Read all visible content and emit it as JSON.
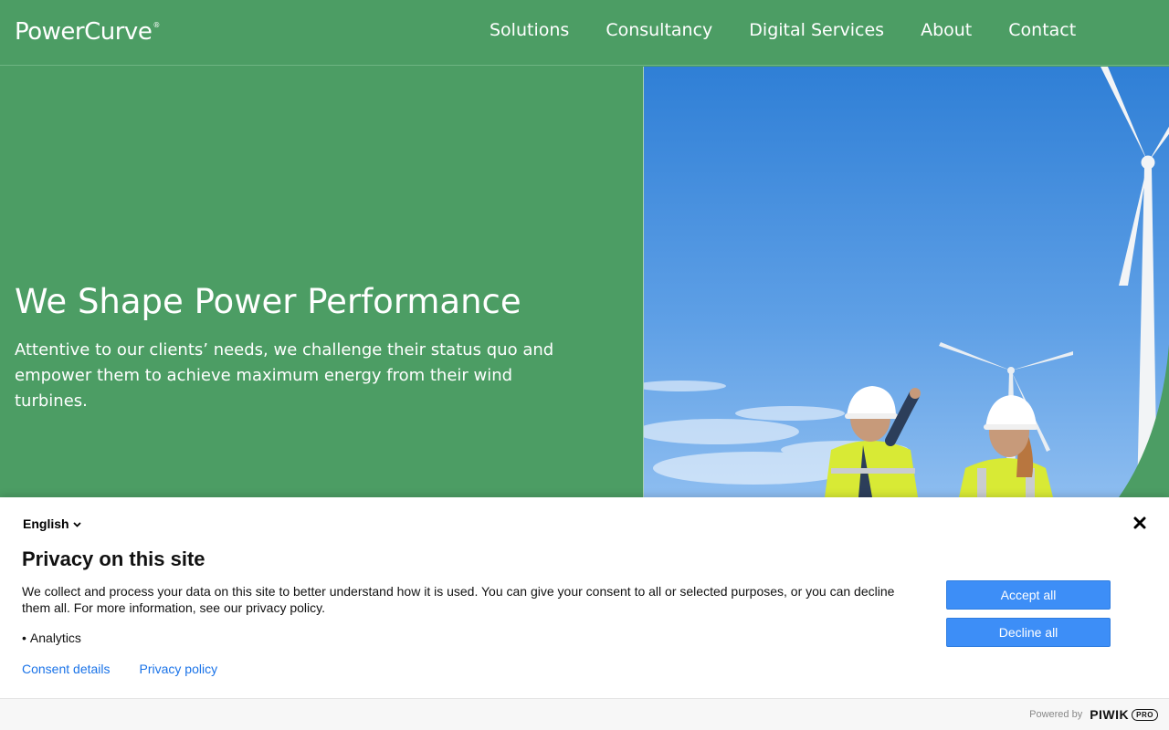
{
  "nav": {
    "logo": "PowerCurve",
    "logo_mark": "®",
    "items": [
      {
        "label": "Solutions"
      },
      {
        "label": "Consultancy"
      },
      {
        "label": "Digital Services"
      },
      {
        "label": "About"
      },
      {
        "label": "Contact"
      }
    ]
  },
  "hero": {
    "title": "We Shape Power Performance",
    "subtitle": "Attentive to our clients’ needs, we challenge their status quo and empower them to achieve maximum energy from their wind turbines."
  },
  "consent": {
    "language": "English",
    "title": "Privacy on this site",
    "text": "We collect and process your data on this site to better understand how it is used. You can give your consent to all or selected purposes, or you can decline them all. For more information, see our privacy policy.",
    "purposes": [
      "Analytics"
    ],
    "consent_details_label": "Consent details",
    "privacy_policy_label": "Privacy policy",
    "accept_label": "Accept all",
    "decline_label": "Decline all",
    "powered_by": "Powered by",
    "brand": "PIWIK",
    "brand_suffix": "PRO"
  },
  "colors": {
    "brand_green": "#4c9d64",
    "button_blue": "#3d8ef7",
    "link_blue": "#1a73e8"
  }
}
